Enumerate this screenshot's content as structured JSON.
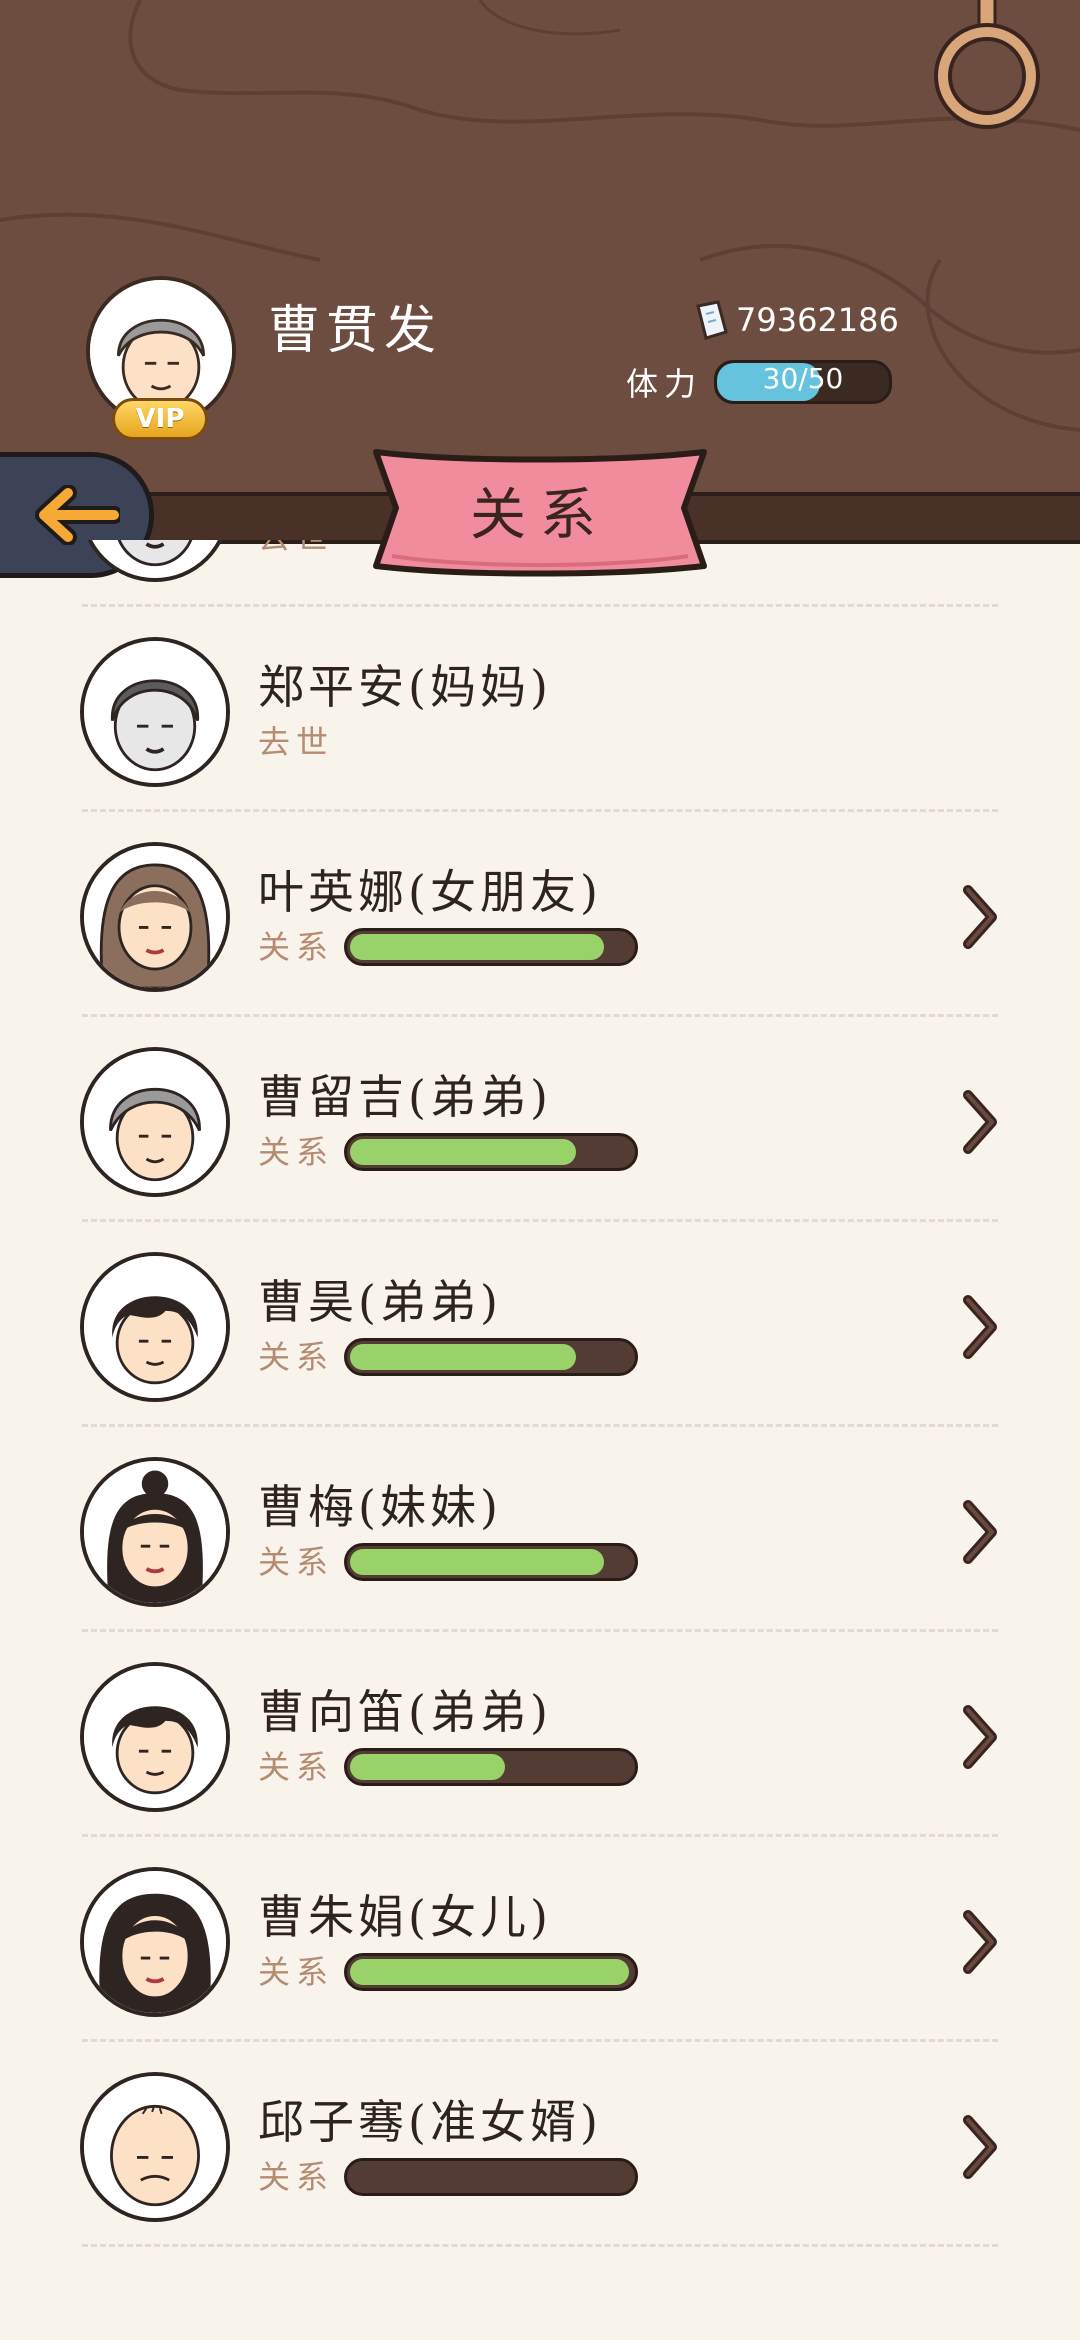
{
  "header": {
    "player_name": "曹贯发",
    "vip_label": "VIP",
    "currency_value": "79362186",
    "stamina_label": "体力",
    "stamina_value": "30/50",
    "stamina_fraction": 0.6,
    "title": "关系"
  },
  "relations": [
    {
      "name": "",
      "status": "去世",
      "deceased": true,
      "avatar": "elder-grey"
    },
    {
      "name": "郑平安(妈妈)",
      "status": "去世",
      "deceased": true,
      "avatar": "elder-grey"
    },
    {
      "name": "叶英娜(女朋友)",
      "rel_label": "关系",
      "level": 0.9,
      "avatar": "woman-brown"
    },
    {
      "name": "曹留吉(弟弟)",
      "rel_label": "关系",
      "level": 0.8,
      "avatar": "elder-grey-hair"
    },
    {
      "name": "曹昊(弟弟)",
      "rel_label": "关系",
      "level": 0.8,
      "avatar": "young-man"
    },
    {
      "name": "曹梅(妹妹)",
      "rel_label": "关系",
      "level": 0.9,
      "avatar": "woman-bun"
    },
    {
      "name": "曹向笛(弟弟)",
      "rel_label": "关系",
      "level": 0.55,
      "avatar": "young-man"
    },
    {
      "name": "曹朱娟(女儿)",
      "rel_label": "关系",
      "level": 0.99,
      "avatar": "woman-long"
    },
    {
      "name": "邱子骞(准女婿)",
      "rel_label": "关系",
      "level": 0.0,
      "avatar": "bald-man"
    }
  ]
}
